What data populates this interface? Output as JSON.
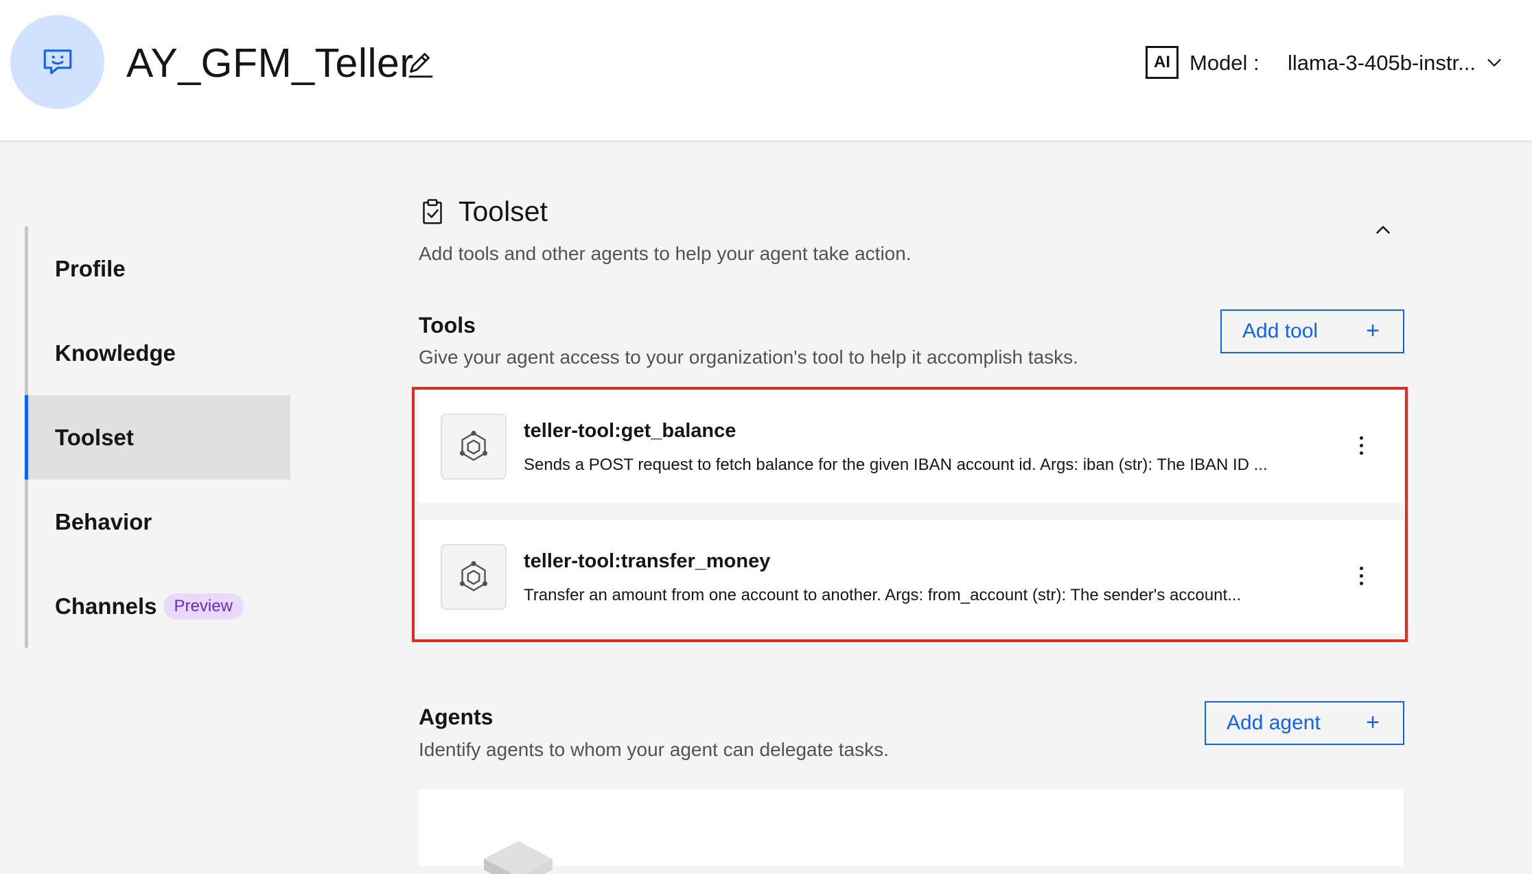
{
  "header": {
    "agent_name": "AY_GFM_Teller",
    "avatar_icon": "chat-bot-icon",
    "edit_icon": "edit-pencil-icon",
    "ai_badge": "AI",
    "model_label": "Model :",
    "model_value": "llama-3-405b-instr...",
    "model_chevron": "chevron-down-icon"
  },
  "sidebar": {
    "items": [
      {
        "label": "Profile"
      },
      {
        "label": "Knowledge"
      },
      {
        "label": "Toolset",
        "active": true
      },
      {
        "label": "Behavior"
      },
      {
        "label": "Channels",
        "tag": "Preview"
      }
    ]
  },
  "toolset": {
    "title": "Toolset",
    "icon": "clipboard-check-icon",
    "description": "Add tools and other agents to help your agent take action.",
    "collapse_icon": "chevron-up-icon"
  },
  "tools": {
    "title": "Tools",
    "description": "Give your agent access to your organization's tool to help it accomplish tasks.",
    "add_label": "Add tool",
    "add_icon": "+",
    "items": [
      {
        "name": "teller-tool:get_balance",
        "description": "Sends a POST request to fetch balance for the given IBAN account id. Args: iban (str): The IBAN ID ...",
        "icon": "tool-hexagon-icon"
      },
      {
        "name": "teller-tool:transfer_money",
        "description": "Transfer an amount from one account to another. Args: from_account (str): The sender's account...",
        "icon": "tool-hexagon-icon"
      }
    ],
    "highlight_color": "#e02d1b"
  },
  "agents": {
    "title": "Agents",
    "description": "Identify agents to whom your agent can delegate tasks.",
    "add_label": "Add agent",
    "add_icon": "+"
  },
  "colors": {
    "accent": "#0f62fe",
    "avatar_bg": "#d0e2ff",
    "tag_bg": "#e8daff",
    "tag_text": "#6929c4"
  }
}
